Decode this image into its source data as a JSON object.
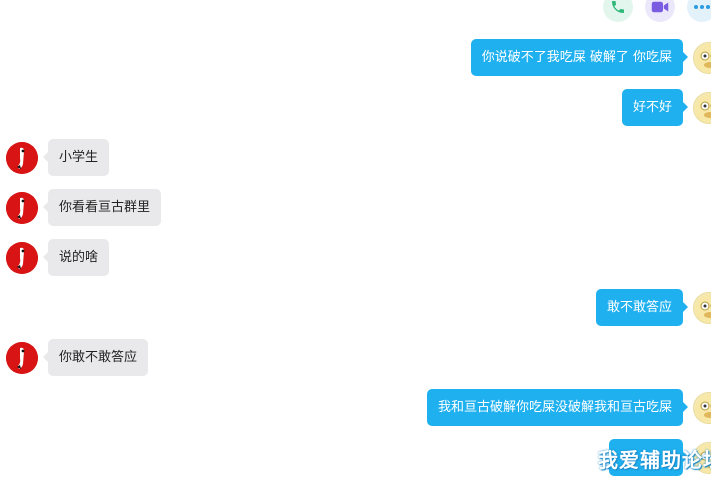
{
  "toolbar": {
    "phone_icon": "phone-icon",
    "video_icon": "video-camera-icon",
    "more_icon": "more-icon"
  },
  "colors": {
    "outgoing_bubble": "#1fb0ef",
    "incoming_bubble": "#e9e9eb",
    "friend_avatar": "#d81414"
  },
  "messages": [
    {
      "from": "me",
      "text": "你说破不了我吃屎 破解了 你吃屎"
    },
    {
      "from": "me",
      "text": "好不好"
    },
    {
      "from": "friend",
      "text": "小学生"
    },
    {
      "from": "friend",
      "text": "你看看亘古群里"
    },
    {
      "from": "friend",
      "text": "说的啥"
    },
    {
      "from": "me",
      "text": "敢不敢答应"
    },
    {
      "from": "friend",
      "text": "你敢不敢答应"
    },
    {
      "from": "me",
      "text": "我和亘古破解你吃屎没破解我和亘古吃屎"
    },
    {
      "from": "me",
      "text": ""
    }
  ],
  "watermark": "我爱辅助论坛"
}
